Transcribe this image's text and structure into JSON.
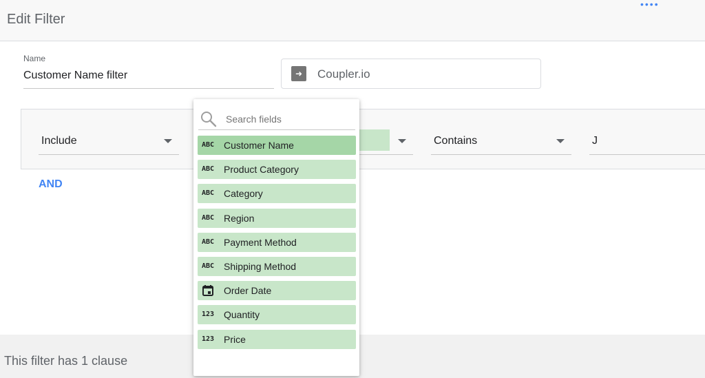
{
  "header": {
    "title": "Edit Filter",
    "menu_dots": "••••"
  },
  "name_field": {
    "label": "Name",
    "value": "Customer Name filter"
  },
  "data_source": {
    "label": "Coupler.io",
    "icon": "arrow-right-icon"
  },
  "clause": {
    "include_value": "Include",
    "condition_value": "Contains",
    "match_value": "J"
  },
  "and_label": "AND",
  "footer": {
    "status": "This filter has 1 clause"
  },
  "dropdown": {
    "search_placeholder": "Search fields",
    "fields": [
      {
        "type": "ABC",
        "label": "Customer Name",
        "selected": true
      },
      {
        "type": "ABC",
        "label": "Product Category"
      },
      {
        "type": "ABC",
        "label": "Category"
      },
      {
        "type": "ABC",
        "label": "Region"
      },
      {
        "type": "ABC",
        "label": "Payment Method"
      },
      {
        "type": "ABC",
        "label": "Shipping Method"
      },
      {
        "type": "calendar-icon",
        "label": "Order Date"
      },
      {
        "type": "123",
        "label": "Quantity"
      },
      {
        "type": "123",
        "label": "Price"
      }
    ]
  },
  "colors": {
    "accent": "#4285f4",
    "field_bg": "#c8e6c9",
    "field_selected_bg": "#a5d6a7"
  }
}
